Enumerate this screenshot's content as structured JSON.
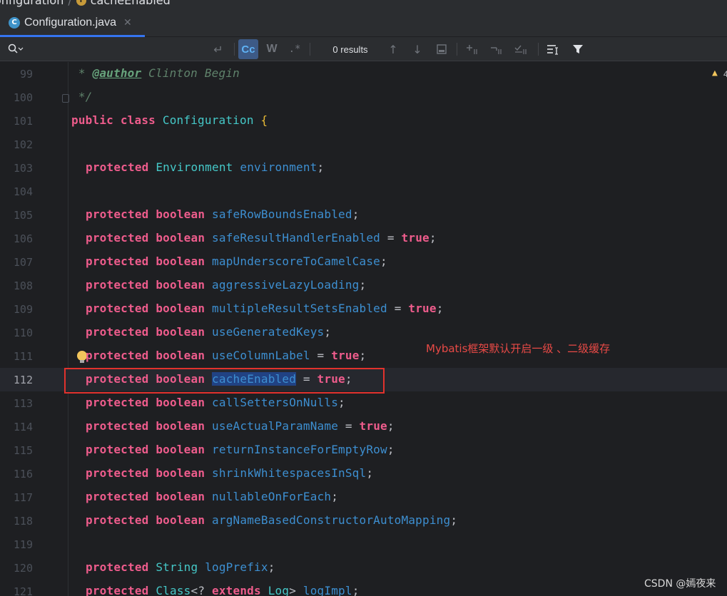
{
  "breadcrumb": {
    "segment1": "onfiguration",
    "segment2": "cacheEnabled"
  },
  "tab": {
    "icon_letter": "C",
    "label": "Configuration.java",
    "close": "✕"
  },
  "searchbar": {
    "case_label": "Cc",
    "word_label": "W",
    "regex_label": ".*",
    "results": "0 results"
  },
  "editor": {
    "warning_count": "4",
    "lines": [
      {
        "no": "99"
      },
      {
        "no": "100"
      },
      {
        "no": "101"
      },
      {
        "no": "102"
      },
      {
        "no": "103"
      },
      {
        "no": "104"
      },
      {
        "no": "105"
      },
      {
        "no": "106"
      },
      {
        "no": "107"
      },
      {
        "no": "108"
      },
      {
        "no": "109"
      },
      {
        "no": "110"
      },
      {
        "no": "111"
      },
      {
        "no": "112"
      },
      {
        "no": "113"
      },
      {
        "no": "114"
      },
      {
        "no": "115"
      },
      {
        "no": "116"
      },
      {
        "no": "117"
      },
      {
        "no": "118"
      },
      {
        "no": "119"
      },
      {
        "no": "120"
      },
      {
        "no": "121"
      }
    ],
    "code": {
      "l99_star": " * ",
      "l99_tag": "@author",
      "l99_text": " Clinton Begin",
      "l100": " */",
      "public": "public",
      "class": "class",
      "classname": "Configuration",
      "brace": "{",
      "protected": "protected",
      "boolean": "boolean",
      "true": "true",
      "Environment": "Environment",
      "environment": "environment",
      "String": "String",
      "logPrefix": "logPrefix",
      "Class": "Class",
      "extends": "extends",
      "Log": "Log",
      "logImpl": "logImpl",
      "f105": "safeRowBoundsEnabled",
      "f106": "safeResultHandlerEnabled",
      "f107": "mapUnderscoreToCamelCase",
      "f108": "aggressiveLazyLoading",
      "f109": "multipleResultSetsEnabled",
      "f110": "useGeneratedKeys",
      "f111": "useColumnLabel",
      "f112": "cacheEnabled",
      "f113": "callSettersOnNulls",
      "f114": "useActualParamName",
      "f115": "returnInstanceForEmptyRow",
      "f116": "shrinkWhitespacesInSql",
      "f117": "nullableOnForEach",
      "f118": "argNameBasedConstructorAutoMapping"
    }
  },
  "annotation": "Mybatis框架默认开启一级 、二级缓存",
  "watermark": "CSDN @嫣夜来"
}
